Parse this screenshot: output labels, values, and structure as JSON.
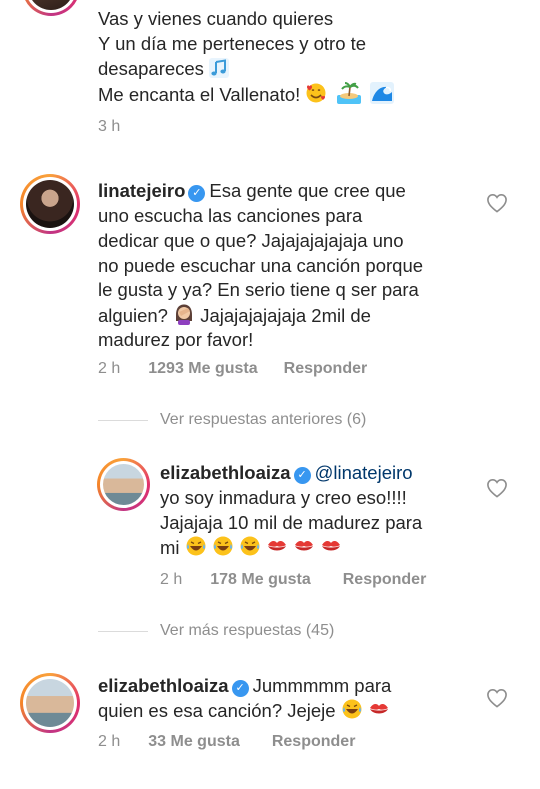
{
  "top_comment": {
    "lines": [
      "Vas y vienes cuando quieres",
      "Y un día me perteneces y otro te",
      "desapareces",
      "Me encanta el Vallenato!"
    ],
    "time": "3 h"
  },
  "comment_lina": {
    "username": "linatejeiro",
    "first_line": "Esa gente que cree que",
    "lines": [
      "uno escucha las canciones  para",
      "dedicar que o que? Jajajajajajaja uno",
      "no puede escuchar una canción porque",
      "le gusta y ya? En serio tiene q ser para",
      "alguien?",
      "madurez por favor!"
    ],
    "line6_tail": "Jajajajajajaja 2mil de",
    "time": "2 h",
    "likes": "1293 Me gusta",
    "reply": "Responder"
  },
  "view_previous": "Ver respuestas anteriores (6)",
  "reply_eliza": {
    "username": "elizabethloaiza",
    "mention": "@linatejeiro",
    "lines": [
      "yo soy inmadura y creo eso!!!!",
      "Jajajaja 10 mil de madurez para",
      "mi"
    ],
    "time": "2 h",
    "likes": "178 Me gusta",
    "reply": "Responder"
  },
  "view_more": "Ver más respuestas (45)",
  "comment_eliza": {
    "username": "elizabethloaiza",
    "first_line": "Jummmmm para",
    "second_line": "quien es esa canción? Jejeje",
    "time": "2 h",
    "likes": "33 Me gusta",
    "reply": "Responder"
  },
  "icons": {
    "like": "heart-outline-icon",
    "verified": "verified-badge-icon"
  },
  "colors": {
    "verified": "#3897f0",
    "muted": "#8e8e8e",
    "mention": "#00376b"
  }
}
